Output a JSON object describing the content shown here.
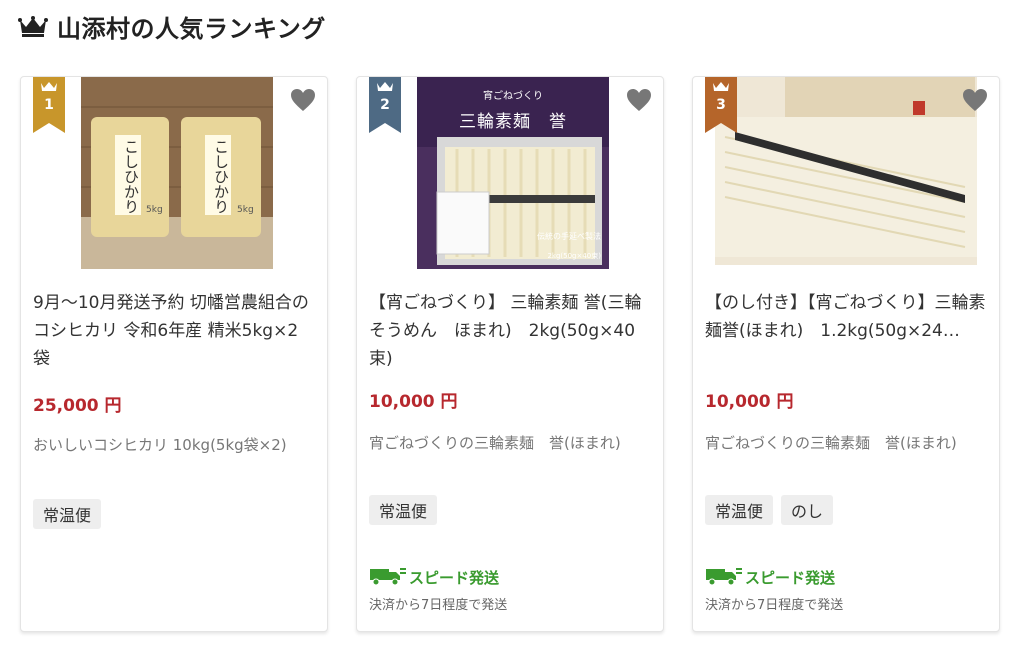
{
  "header": {
    "title": "山添村の人気ランキング",
    "icon": "crown-icon",
    "icon_color": "#222222"
  },
  "colors": {
    "price": "#b7282e",
    "badge_gold": "#c8962b",
    "badge_silver": "#4e6a84",
    "badge_bronze": "#b5652a",
    "speed": "#3a9b2f"
  },
  "cards": [
    {
      "rank": "1",
      "name": "9月～10月発送予約 切幡営農組合のコシヒカリ 令和6年産 精米5kg×2袋",
      "price": "25,000 円",
      "desc": "おいしいコシヒカリ 10kg(5kg袋×2)",
      "tags": [
        "常温便"
      ],
      "image_label": "こしひかり",
      "image_sublabel": "5kg"
    },
    {
      "rank": "2",
      "name": "【宵ごねづくり】 三輪素麺 誉(三輪そうめん　ほまれ)　2kg(50g×40束)",
      "price": "10,000 円",
      "desc": "宵ごねづくりの三輪素麺　誉(ほまれ)",
      "tags": [
        "常温便"
      ],
      "speed": "スピード発送",
      "speed_note": "決済から7日程度で発送",
      "image_label": "宵ごねづくり",
      "image_title": "三輪素麺　誉",
      "image_caption": "伝統の手延べ製法",
      "image_caption2": "2kg(50g×40束)"
    },
    {
      "rank": "3",
      "name": "【のし付き】【宵ごねづくり】三輪素麺誉(ほまれ)　1.2kg(50g×24…",
      "price": "10,000 円",
      "desc": "宵ごねづくりの三輪素麺　誉(ほまれ)",
      "tags": [
        "常温便",
        "のし"
      ],
      "speed": "スピード発送",
      "speed_note": "決済から7日程度で発送"
    }
  ]
}
